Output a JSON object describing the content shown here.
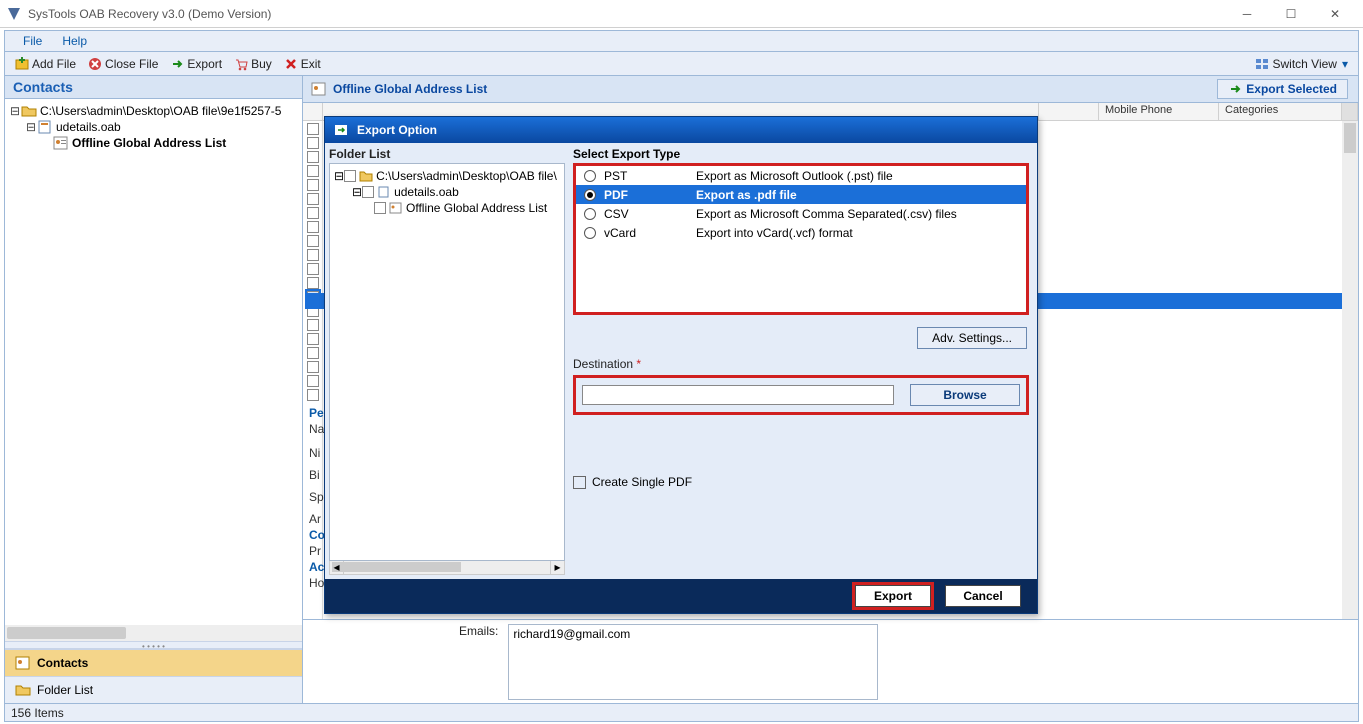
{
  "titlebar": {
    "title": "SysTools OAB Recovery v3.0 (Demo Version)"
  },
  "menu": {
    "file": "File",
    "help": "Help"
  },
  "toolbar": {
    "add_file": "Add File",
    "close_file": "Close File",
    "export": "Export",
    "buy": "Buy",
    "exit": "Exit",
    "switch_view": "Switch View"
  },
  "left": {
    "header": "Contacts",
    "tree": {
      "root": "C:\\Users\\admin\\Desktop\\OAB file\\9e1f5257-5",
      "file": "udetails.oab",
      "list": "Offline Global Address List"
    },
    "nav_contacts": "Contacts",
    "nav_folderlist": "Folder List"
  },
  "right": {
    "header": "Offline Global Address List",
    "export_selected": "Export Selected",
    "cols": {
      "mobile": "Mobile Phone",
      "categories": "Categories"
    },
    "details": {
      "pe": "Pe",
      "na": "Na",
      "ni": "Ni",
      "bi": "Bi",
      "sp": "Sp",
      "ar": "Ar",
      "co": "Co",
      "pr": "Pr",
      "ac": "Ac",
      "ho": "Ho"
    },
    "emails_label": "Emails:",
    "email_value": "richard19@gmail.com"
  },
  "modal": {
    "title": "Export Option",
    "folder_list_label": "Folder List",
    "folder_tree": {
      "root": "C:\\Users\\admin\\Desktop\\OAB file\\",
      "file": "udetails.oab",
      "list": "Offline Global Address List"
    },
    "select_type_label": "Select Export Type",
    "types": [
      {
        "name": "PST",
        "desc": "Export as Microsoft Outlook (.pst) file",
        "selected": false
      },
      {
        "name": "PDF",
        "desc": "Export as .pdf file",
        "selected": true
      },
      {
        "name": "CSV",
        "desc": "Export as Microsoft Comma Separated(.csv) files",
        "selected": false
      },
      {
        "name": "vCard",
        "desc": "Export into vCard(.vcf) format",
        "selected": false
      }
    ],
    "adv_settings": "Adv. Settings...",
    "destination_label": "Destination",
    "destination_value": "",
    "browse": "Browse",
    "create_single_pdf": "Create Single PDF",
    "export_btn": "Export",
    "cancel_btn": "Cancel"
  },
  "status": {
    "items": "156 Items"
  }
}
